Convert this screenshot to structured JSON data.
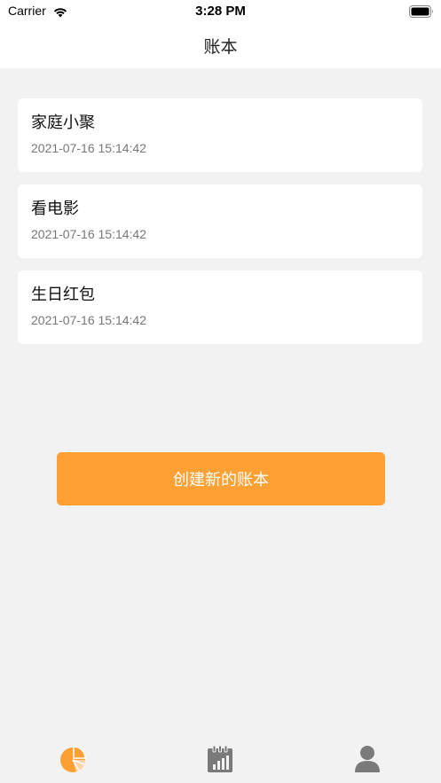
{
  "status_bar": {
    "carrier": "Carrier",
    "time": "3:28 PM"
  },
  "nav": {
    "title": "账本"
  },
  "books": [
    {
      "name": "家庭小聚",
      "time": "2021-07-16 15:14:42"
    },
    {
      "name": "看电影",
      "time": "2021-07-16 15:14:42"
    },
    {
      "name": "生日红包",
      "time": "2021-07-16 15:14:42"
    }
  ],
  "create_button": {
    "label": "创建新的账本"
  },
  "tab_bar": {
    "tabs": [
      {
        "icon": "pie-chart-icon",
        "active": true
      },
      {
        "icon": "stats-calendar-icon",
        "active": false
      },
      {
        "icon": "user-icon",
        "active": false
      }
    ]
  },
  "colors": {
    "accent": "#ffa035",
    "inactive_icon": "#7a7a7a",
    "background": "#f2f2f2"
  }
}
